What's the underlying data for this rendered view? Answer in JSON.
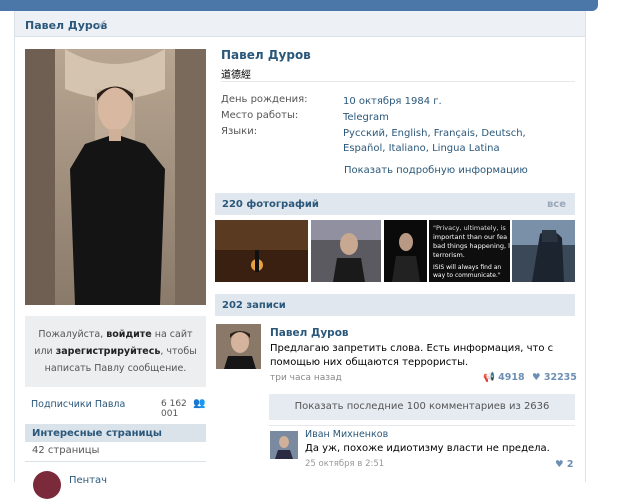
{
  "header": {
    "name": "Павел Дуров"
  },
  "profile": {
    "name": "Павел Дуров",
    "status": "道德經",
    "info": [
      {
        "key": "День рождения:",
        "value": "10 октября 1984 г."
      },
      {
        "key": "Место работы:",
        "value": "Telegram"
      },
      {
        "key": "Языки:",
        "value": "Русский, English, Français, Deutsch, Español, Italiano, Lingua Latina"
      }
    ],
    "show_more": "Показать подробную информацию"
  },
  "message_box": {
    "pre": "Пожалуйста, ",
    "login": "войдите",
    "mid": " на сайт или ",
    "register": "зарегистрируйтесь",
    "post": ", чтобы написать Павлу сообщение."
  },
  "subscribers": {
    "label": "Подписчики Павла",
    "count": "6 162 001"
  },
  "interesting": {
    "title": "Интересные страницы",
    "count": "42 страницы",
    "first": "Пентач"
  },
  "photos": {
    "title": "220 фотографий",
    "all": "все"
  },
  "wall": {
    "title": "202 записи",
    "post": {
      "author": "Павел Дуров",
      "text": "Предлагаю запретить слова. Есть информация, что с помощью них общаются террористы.",
      "time": "три часа назад",
      "shares": "4918",
      "likes": "32235"
    },
    "show_comments": "Показать последние 100 комментариев из 2636",
    "comment": {
      "author": "Иван Михненков",
      "text": "Да уж, похоже идиотизму власти не предела.",
      "time": "25 октября в 2:51",
      "likes": "2"
    }
  },
  "colors": {
    "link": "#2b587a",
    "top_bar": "#4a76a8",
    "section": "#e1e7ee"
  }
}
